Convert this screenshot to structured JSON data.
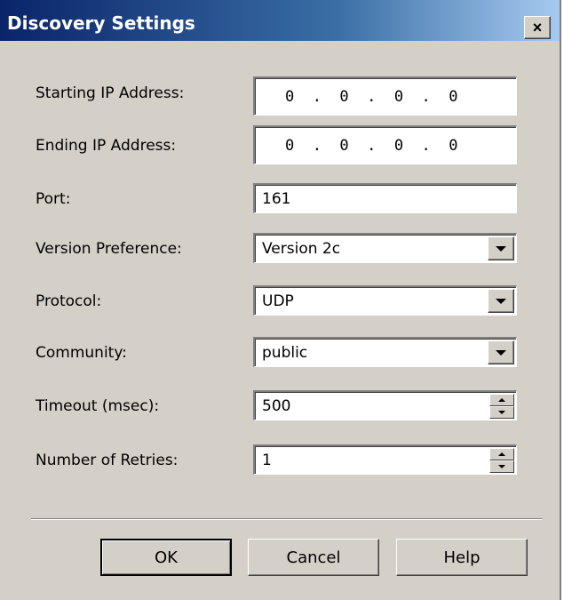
{
  "window": {
    "title": "Discovery Settings",
    "close_label": "×"
  },
  "fields": {
    "starting_ip": {
      "label": "Starting IP Address:",
      "value": "0  .  0  .  0  .  0"
    },
    "ending_ip": {
      "label": "Ending IP Address:",
      "value": "0  .  0  .  0  .  0"
    },
    "port": {
      "label": "Port:",
      "value": "161"
    },
    "version": {
      "label": "Version Preference:",
      "value": "Version 2c"
    },
    "protocol": {
      "label": "Protocol:",
      "value": "UDP"
    },
    "community": {
      "label": "Community:",
      "value": "public"
    },
    "timeout": {
      "label": "Timeout (msec):",
      "value": "500"
    },
    "retries": {
      "label": "Number of Retries:",
      "value": "1"
    }
  },
  "buttons": {
    "ok": "OK",
    "cancel": "Cancel",
    "help": "Help"
  },
  "icons": {
    "dropdown": "chevron-down-icon",
    "spinner": "spin-up-down-icon",
    "close": "close-icon"
  },
  "colors": {
    "title_start": "#0a246a",
    "title_end": "#a6caf0",
    "face": "#d4d0c8"
  }
}
